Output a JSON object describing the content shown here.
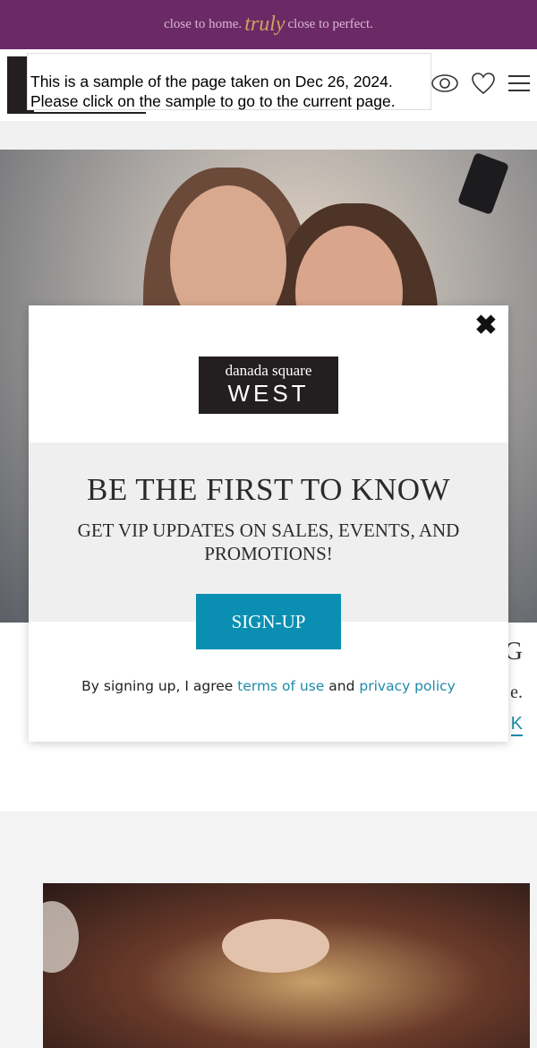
{
  "topbar": {
    "pre": "close to home.",
    "truly": "truly",
    "post": "close to perfect."
  },
  "header": {
    "icons": [
      "eye-icon",
      "heart-icon",
      "menu-icon"
    ]
  },
  "sample_notice": {
    "line1": "This is a sample of the page taken on Dec 26, 2024.",
    "line2": "Please click on the sample to go to the current page."
  },
  "background_section": {
    "heading_fragment": "G",
    "text_fragment": "e.",
    "link_fragment": "K"
  },
  "modal": {
    "close_glyph": "✖",
    "brand_line1": "danada square",
    "brand_line2": "WEST",
    "title": "BE THE FIRST TO KNOW",
    "subtitle": "GET VIP UPDATES ON SALES, EVENTS, AND PROMOTIONS!",
    "button_label": "SIGN-UP",
    "agree_prefix": "By signing up, I agree ",
    "terms_link": "terms of use",
    "agree_mid": " and ",
    "privacy_link": "privacy policy"
  },
  "colors": {
    "topbar_bg": "#6b2a66",
    "accent_gold": "#c9a35d",
    "button_bg": "#0a8fb3",
    "link": "#1f8ba8",
    "brand_box": "#231f20"
  }
}
